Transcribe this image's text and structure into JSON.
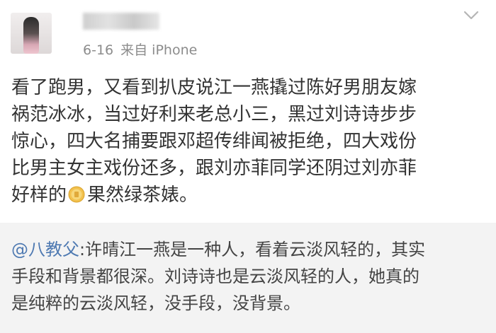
{
  "post": {
    "date": "6-16",
    "source": "来自 iPhone",
    "text_lines": [
      "看了跑男，又看到扒皮说江一燕撬过陈好男朋友嫁",
      "祸范冰冰，当过好利来老总小三，黑过刘诗诗步步",
      "惊心，四大名捕要跟邓超传绯闻被拒绝，四大戏份",
      "比男主女主戏份还多，跟刘亦菲同学还阴过刘亦菲"
    ],
    "last_line_before": "好样的",
    "last_line_after": "果然绿茶婊。",
    "emoji_icon": "gold-coin-emoji"
  },
  "repost": {
    "mention": "@八教父",
    "first_line_rest": ":许晴江一燕是一种人，看着云淡风轻的，其实",
    "lines": [
      "手段和背景都很深。刘诗诗也是云淡风轻的人，她真的",
      "是纯粹的云淡风轻，没手段，没背景。"
    ]
  },
  "colors": {
    "meta_gray": "#8c8c8c",
    "mention_blue": "#4f7ab2",
    "repost_bg": "#f3f3f3"
  }
}
